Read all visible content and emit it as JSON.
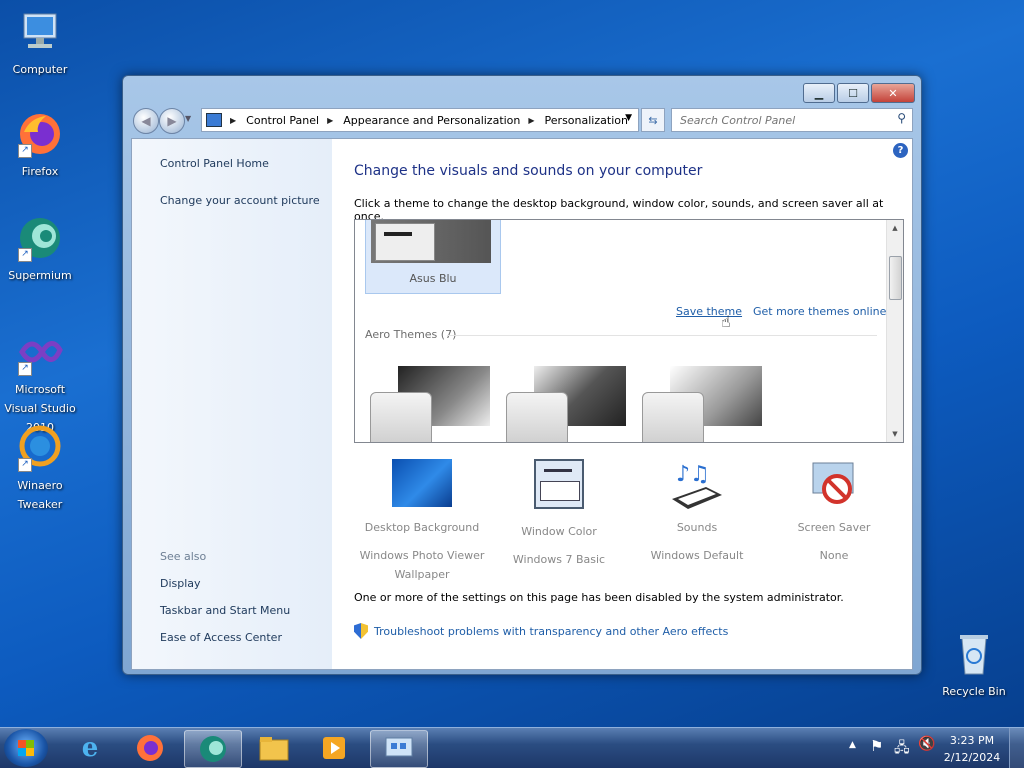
{
  "desktop": {
    "icons": [
      {
        "label": "Computer"
      },
      {
        "label": "Firefox"
      },
      {
        "label": "Supermium"
      },
      {
        "label": "Microsoft Visual Studio 2010"
      },
      {
        "label": "Winaero Tweaker"
      },
      {
        "label": "Recycle Bin"
      }
    ]
  },
  "window": {
    "address": {
      "segments": [
        "Control Panel",
        "Appearance and Personalization",
        "Personalization"
      ]
    },
    "search": {
      "placeholder": "Search Control Panel"
    },
    "left_pane": {
      "links": [
        "Control Panel Home",
        "Change your account picture"
      ],
      "see_also_label": "See also",
      "see_also": [
        "Display",
        "Taskbar and Start Menu",
        "Ease of Access Center"
      ]
    },
    "main": {
      "title": "Change the visuals and sounds on your computer",
      "subtitle": "Click a theme to change the desktop background, window color, sounds, and screen saver all at once.",
      "selected_theme": "Asus Blu",
      "save_theme": "Save theme",
      "get_more": "Get more themes online",
      "aero_section": "Aero Themes (7)",
      "settings": [
        {
          "title": "Desktop Background",
          "value": "Windows Photo Viewer Wallpaper"
        },
        {
          "title": "Window Color",
          "value": "Windows 7 Basic"
        },
        {
          "title": "Sounds",
          "value": "Windows Default"
        },
        {
          "title": "Screen Saver",
          "value": "None"
        }
      ],
      "notice": "One or more of the settings on this page has been disabled by the system administrator.",
      "troubleshoot": "Troubleshoot problems with transparency and other Aero effects"
    }
  },
  "taskbar": {
    "time": "3:23 PM",
    "date": "2/12/2024"
  }
}
